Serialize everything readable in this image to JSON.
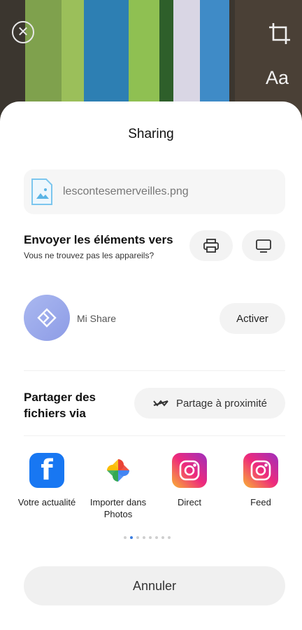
{
  "header": {
    "title": "Sharing",
    "text_tool_label": "Aa"
  },
  "file": {
    "name": "lescontesemerveilles.png"
  },
  "send_section": {
    "title": "Envoyer les éléments vers",
    "subtitle": "Vous ne trouvez pas les appareils?"
  },
  "mi_share": {
    "label": "Mi Share",
    "activate_label": "Activer"
  },
  "share_section": {
    "title": "Partager des fichiers via",
    "nearby_label": "Partage à proximité"
  },
  "apps": [
    {
      "icon": "facebook-icon",
      "label": "Votre actualité"
    },
    {
      "icon": "google-photos-icon",
      "label": "Importer dans Photos"
    },
    {
      "icon": "instagram-icon",
      "label": "Direct"
    },
    {
      "icon": "instagram-icon",
      "label": "Feed"
    }
  ],
  "pagination": {
    "pages": 8,
    "current": 2
  },
  "cancel_label": "Annuler",
  "colors": {
    "facebook": "#1877f2",
    "active_dot": "#3b7de0",
    "sheet_bg": "#ffffff",
    "button_bg": "#f3f3f3"
  }
}
